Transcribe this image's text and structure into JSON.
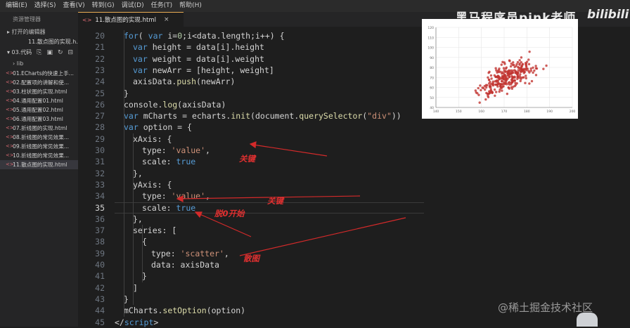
{
  "menubar": {
    "items": [
      "编辑(E)",
      "选择(S)",
      "查看(V)",
      "转到(G)",
      "调试(D)",
      "任务(T)",
      "帮助(H)"
    ]
  },
  "sidebar": {
    "header": "资源管理器",
    "open_editors_label": "▸ 打开的编辑器",
    "open_file": "11.散点图的实现.h...",
    "project_label": "▾ 03.代码",
    "lib_label": "lib",
    "files": [
      "01.ECharts的快速上手...",
      "02.配置项的讲解和使...",
      "03.柱状图的实现.html",
      "04.通用配置01.html",
      "05.通用配置02.html",
      "06.通用配置03.html",
      "07.折线图的实现.html",
      "08.折线图的常见效果...",
      "09.折线图的常见效果...",
      "10.折线图的常见效果...",
      "11.散点图的实现.html"
    ],
    "active_index": 10
  },
  "tab": {
    "label": "11.散点图的实现.html",
    "close": "×"
  },
  "editor": {
    "current_line": "35",
    "lines": [
      {
        "no": "20",
        "indent": 1,
        "parts": [
          [
            "k",
            "for"
          ],
          [
            "t",
            "( "
          ],
          [
            "k",
            "var"
          ],
          [
            "t",
            " i="
          ],
          [
            "n",
            "0"
          ],
          [
            "t",
            ";i<data.length;i++) {"
          ]
        ]
      },
      {
        "no": "21",
        "indent": 2,
        "parts": [
          [
            "k",
            "var"
          ],
          [
            "t",
            " height = data[i].height"
          ]
        ]
      },
      {
        "no": "22",
        "indent": 2,
        "parts": [
          [
            "k",
            "var"
          ],
          [
            "t",
            " weight = data[i].weight"
          ]
        ]
      },
      {
        "no": "23",
        "indent": 2,
        "parts": [
          [
            "k",
            "var"
          ],
          [
            "t",
            " newArr = [height, weight]"
          ]
        ]
      },
      {
        "no": "24",
        "indent": 2,
        "parts": [
          [
            "t",
            "axisData."
          ],
          [
            "f",
            "push"
          ],
          [
            "t",
            "(newArr)"
          ]
        ]
      },
      {
        "no": "25",
        "indent": 1,
        "parts": [
          [
            "t",
            "}"
          ]
        ]
      },
      {
        "no": "26",
        "indent": 1,
        "parts": [
          [
            "t",
            "console."
          ],
          [
            "f",
            "log"
          ],
          [
            "t",
            "(axisData)"
          ]
        ]
      },
      {
        "no": "27",
        "indent": 1,
        "parts": [
          [
            "k",
            "var"
          ],
          [
            "t",
            " mCharts = echarts."
          ],
          [
            "f",
            "init"
          ],
          [
            "t",
            "(document."
          ],
          [
            "f",
            "querySelector"
          ],
          [
            "t",
            "("
          ],
          [
            "s",
            "\"div\""
          ],
          [
            "t",
            "))"
          ]
        ]
      },
      {
        "no": "28",
        "indent": 1,
        "parts": [
          [
            "k",
            "var"
          ],
          [
            "t",
            " option = {"
          ]
        ]
      },
      {
        "no": "29",
        "indent": 2,
        "parts": [
          [
            "t",
            "xAxis: {"
          ]
        ]
      },
      {
        "no": "30",
        "indent": 3,
        "parts": [
          [
            "t",
            "type: "
          ],
          [
            "s",
            "'value'"
          ],
          [
            "t",
            ","
          ]
        ]
      },
      {
        "no": "31",
        "indent": 3,
        "parts": [
          [
            "t",
            "scale: "
          ],
          [
            "k",
            "true"
          ]
        ]
      },
      {
        "no": "32",
        "indent": 2,
        "parts": [
          [
            "t",
            "},"
          ]
        ]
      },
      {
        "no": "33",
        "indent": 2,
        "parts": [
          [
            "t",
            "yAxis: {"
          ]
        ]
      },
      {
        "no": "34",
        "indent": 3,
        "parts": [
          [
            "t",
            "type: "
          ],
          [
            "s",
            "'value'"
          ],
          [
            "t",
            ","
          ]
        ]
      },
      {
        "no": "35",
        "indent": 3,
        "parts": [
          [
            "t",
            "scale: "
          ],
          [
            "k",
            "true"
          ]
        ]
      },
      {
        "no": "36",
        "indent": 2,
        "parts": [
          [
            "t",
            "},"
          ]
        ]
      },
      {
        "no": "37",
        "indent": 2,
        "parts": [
          [
            "t",
            "series: ["
          ]
        ]
      },
      {
        "no": "38",
        "indent": 3,
        "parts": [
          [
            "t",
            "{"
          ]
        ]
      },
      {
        "no": "39",
        "indent": 4,
        "parts": [
          [
            "t",
            "type: "
          ],
          [
            "s",
            "'scatter'"
          ],
          [
            "t",
            ","
          ]
        ]
      },
      {
        "no": "40",
        "indent": 4,
        "parts": [
          [
            "t",
            "data: axisData"
          ]
        ]
      },
      {
        "no": "41",
        "indent": 3,
        "parts": [
          [
            "t",
            "}"
          ]
        ]
      },
      {
        "no": "42",
        "indent": 2,
        "parts": [
          [
            "t",
            "]"
          ]
        ]
      },
      {
        "no": "43",
        "indent": 1,
        "parts": [
          [
            "t",
            "}"
          ]
        ]
      },
      {
        "no": "44",
        "indent": 1,
        "parts": [
          [
            "t",
            "mCharts."
          ],
          [
            "f",
            "setOption"
          ],
          [
            "t",
            "(option)"
          ]
        ]
      },
      {
        "no": "45",
        "indent": 0,
        "parts": [
          [
            "t",
            "</"
          ],
          [
            "k",
            "script"
          ],
          [
            "t",
            ">"
          ]
        ]
      }
    ]
  },
  "annotations": {
    "xaxis_key": "关键",
    "yaxis_key": "关键",
    "not_from_zero": "脱0开始",
    "scatter": "散图"
  },
  "watermarks": {
    "top": "黑马程序员pink老师",
    "site": "bilibili",
    "bottom": "@稀土掘金技术社区"
  },
  "chart_data": {
    "type": "scatter",
    "title": "",
    "xlabel": "",
    "ylabel": "",
    "xlim": [
      140,
      200
    ],
    "ylim": [
      40,
      120
    ],
    "x_ticks": [
      "140",
      "150",
      "160",
      "170",
      "180",
      "190",
      "200"
    ],
    "y_ticks": [
      "40",
      "50",
      "60",
      "70",
      "80",
      "90",
      "100",
      "110",
      "120"
    ],
    "grid": true,
    "point_color": "#c23531",
    "point_count": 300,
    "x_mean": 171,
    "x_spread": 9,
    "y_intercept": -110,
    "y_slope": 1.05,
    "y_spread": 9
  },
  "colors": {
    "keyword": "#569cd6",
    "string": "#ce9178",
    "number": "#b5cea8",
    "function": "#dcdcaa",
    "annotation": "#e03030",
    "tab_accent": "#e8ab53"
  }
}
